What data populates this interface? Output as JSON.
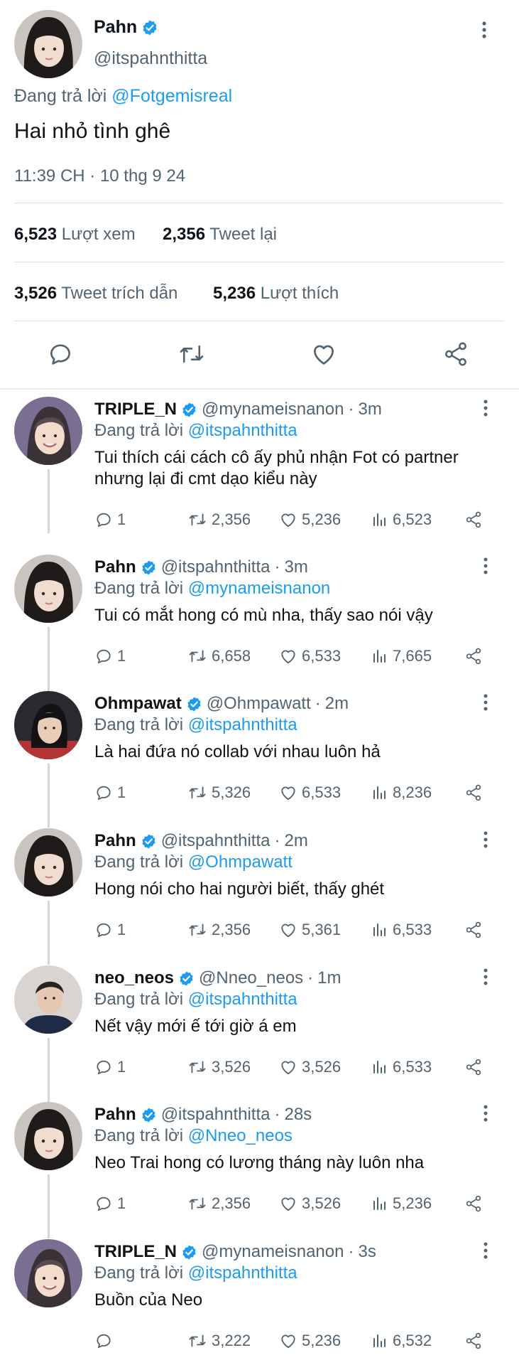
{
  "colors": {
    "accent": "#1d9bf0",
    "text": "#0f1419",
    "muted": "#536471",
    "divider": "#dbe1e6"
  },
  "main": {
    "name": "Pahn",
    "handle": "@itspahnthitta",
    "replying_prefix": "Đang trả lời",
    "replying_to": "@Fotgemisreal",
    "text": "Hai nhỏ tình ghê",
    "timestamp": "11:39 CH · 10 thg 9 24",
    "views_count": "6,523",
    "views_label": "Lượt xem",
    "retweets_count": "2,356",
    "retweets_label": "Tweet lại",
    "quotes_count": "3,526",
    "quotes_label": "Tweet trích dẫn",
    "likes_count": "5,236",
    "likes_label": "Lượt thích",
    "icons": [
      "reply-icon",
      "retweet-icon",
      "like-icon",
      "share-icon"
    ]
  },
  "replies": [
    {
      "name": "TRIPLE_N",
      "handle": "@mynameisnanon",
      "time": "3m",
      "replying_prefix": "Đang trả lời",
      "replying_to": "@itspahnthitta",
      "text": "Tui thích cái cách cô ấy phủ nhận Fot có partner nhưng lại đi cmt dạo kiểu này",
      "replies": "1",
      "retweets": "2,356",
      "likes": "5,236",
      "views": "6,523"
    },
    {
      "name": "Pahn",
      "handle": "@itspahnthitta",
      "time": "3m",
      "replying_prefix": "Đang trả lời",
      "replying_to": "@mynameisnanon",
      "text": "Tui có mắt hong có mù nha, thấy sao nói vậy",
      "replies": "1",
      "retweets": "6,658",
      "likes": "6,533",
      "views": "7,665"
    },
    {
      "name": "Ohmpawat",
      "handle": "@Ohmpawatt",
      "time": "2m",
      "replying_prefix": "Đang trả lời",
      "replying_to": "@itspahnthitta",
      "text": "Là hai đứa nó collab với nhau luôn hả",
      "replies": "1",
      "retweets": "5,326",
      "likes": "6,533",
      "views": "8,236"
    },
    {
      "name": "Pahn",
      "handle": "@itspahnthitta",
      "time": "2m",
      "replying_prefix": "Đang trả lời",
      "replying_to": "@Ohmpawatt",
      "text": "Hong nói cho hai người biết, thấy ghét",
      "replies": "1",
      "retweets": "2,356",
      "likes": "5,361",
      "views": "6,533"
    },
    {
      "name": "neo_neos",
      "handle": "@Nneo_neos",
      "time": "1m",
      "replying_prefix": "Đang trả lời",
      "replying_to": "@itspahnthitta",
      "text": "Nết vậy mới ế tới giờ á em",
      "replies": "1",
      "retweets": "3,526",
      "likes": "3,526",
      "views": "6,533"
    },
    {
      "name": "Pahn",
      "handle": "@itspahnthitta",
      "time": "28s",
      "replying_prefix": "Đang trả lời",
      "replying_to": "@Nneo_neos",
      "text": "Neo Trai hong có lương tháng này luôn nha",
      "replies": "1",
      "retweets": "2,356",
      "likes": "3,526",
      "views": "5,236"
    },
    {
      "name": "TRIPLE_N",
      "handle": "@mynameisnanon",
      "time": "3s",
      "replying_prefix": "Đang trả lời",
      "replying_to": "@itspahnthitta",
      "text": "Buồn của Neo",
      "replies": "",
      "retweets": "3,222",
      "likes": "5,236",
      "views": "6,532"
    }
  ]
}
